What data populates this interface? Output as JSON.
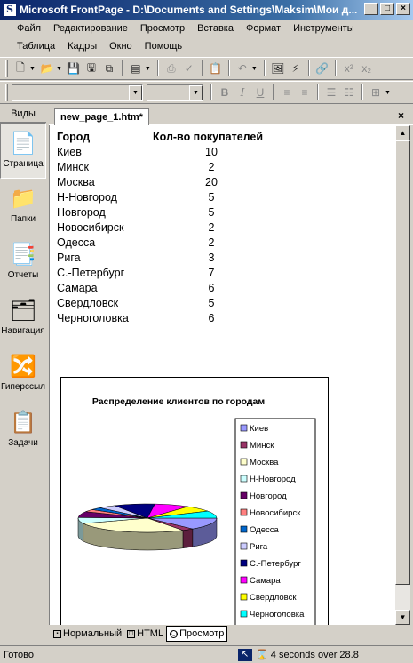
{
  "window": {
    "title": "Microsoft FrontPage - D:\\Documents and Settings\\Maksim\\Мои д...",
    "buttons": [
      "_",
      "□",
      "×"
    ]
  },
  "menu": {
    "row1": [
      "Файл",
      "Редактирование",
      "Просмотр",
      "Вставка",
      "Формат",
      "Инструменты"
    ],
    "row2": [
      "Таблица",
      "Кадры",
      "Окно",
      "Помощь"
    ]
  },
  "views": {
    "header": "Виды",
    "items": [
      {
        "label": "Страница",
        "icon": "page-view-icon"
      },
      {
        "label": "Папки",
        "icon": "folders-icon"
      },
      {
        "label": "Отчеты",
        "icon": "reports-icon"
      },
      {
        "label": "Навигация",
        "icon": "navigation-icon"
      },
      {
        "label": "Гиперссылки",
        "icon": "hyperlinks-icon"
      },
      {
        "label": "Задачи",
        "icon": "tasks-icon"
      }
    ]
  },
  "document": {
    "tab": "new_page_1.htm*",
    "headers": [
      "Город",
      "Кол-во покупателей"
    ],
    "rows": [
      [
        "Киев",
        "10"
      ],
      [
        "Минск",
        "2"
      ],
      [
        "Москва",
        "20"
      ],
      [
        "Н-Новгород",
        "5"
      ],
      [
        "Новгород",
        "5"
      ],
      [
        "Новосибирск",
        "2"
      ],
      [
        "Одесса",
        "2"
      ],
      [
        "Рига",
        "3"
      ],
      [
        "С.-Петербург",
        "7"
      ],
      [
        "Самара",
        "6"
      ],
      [
        "Свердловск",
        "5"
      ],
      [
        "Черноголовка",
        "6"
      ]
    ]
  },
  "chart_data": {
    "type": "pie",
    "title": "Распределение клиентов по городам",
    "categories": [
      "Киев",
      "Минск",
      "Москва",
      "Н-Новгород",
      "Новгород",
      "Новосибирск",
      "Одесса",
      "Рига",
      "С.-Петербург",
      "Самара",
      "Свердловск",
      "Черноголовка"
    ],
    "values": [
      10,
      2,
      20,
      5,
      5,
      2,
      2,
      3,
      7,
      6,
      5,
      6
    ],
    "colors": [
      "#9999ff",
      "#993366",
      "#ffffcc",
      "#ccffff",
      "#660066",
      "#ff8080",
      "#0066cc",
      "#ccccff",
      "#000080",
      "#ff00ff",
      "#ffff00",
      "#00ffff"
    ],
    "legend": "right",
    "style": "3d"
  },
  "viewtabs": [
    "Нормальный",
    "HTML",
    "Просмотр"
  ],
  "status": {
    "left": "Готово",
    "right": "4 seconds over 28.8"
  }
}
